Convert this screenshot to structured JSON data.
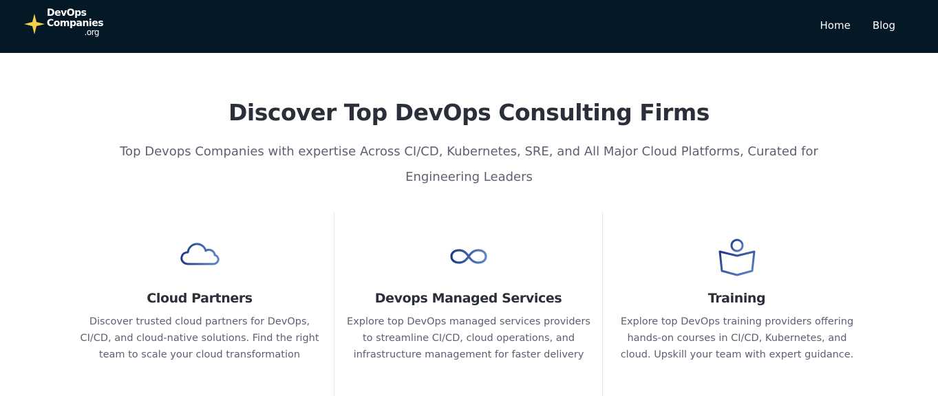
{
  "brand": {
    "logo_line1": "DevOps",
    "logo_line2": "Companies",
    "logo_line3": ".org",
    "star_color": "#f5d04a"
  },
  "nav": {
    "items": [
      {
        "label": "Home"
      },
      {
        "label": "Blog"
      }
    ]
  },
  "hero": {
    "title": "Discover Top DevOps Consulting Firms",
    "subtitle": "Top Devops Companies with expertise Across CI/CD, Kubernetes, SRE, and All Major Cloud Platforms, Curated for Engineering Leaders"
  },
  "features": [
    {
      "icon": "cloud-icon",
      "title": "Cloud Partners",
      "description": "Discover trusted cloud partners for DevOps, CI/CD, and cloud-native solutions. Find the right team to scale your cloud transformation"
    },
    {
      "icon": "infinity-icon",
      "title": "Devops Managed Services",
      "description": "Explore top DevOps managed services providers to streamline CI/CD, cloud operations, and infrastructure management for faster delivery"
    },
    {
      "icon": "training-icon",
      "title": "Training",
      "description": "Explore top DevOps training providers offering hands-on courses in CI/CD, Kubernetes, and cloud. Upskill your team with expert guidance."
    }
  ],
  "colors": {
    "navbar_bg": "#051826",
    "icon_gradient_start": "#1f3a86",
    "icon_gradient_end": "#5f86c9"
  }
}
